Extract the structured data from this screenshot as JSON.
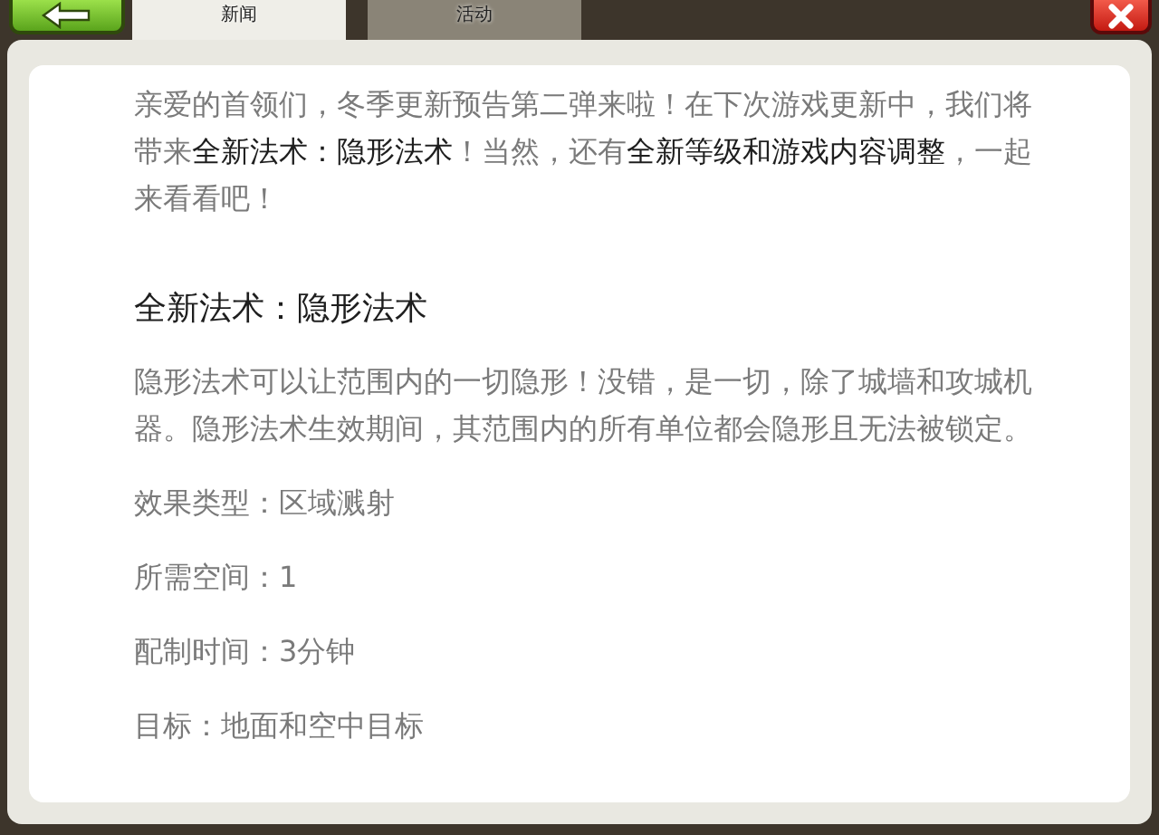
{
  "tabs": [
    {
      "label": "新闻",
      "selected": true
    },
    {
      "label": "活动",
      "selected": false
    }
  ],
  "article": {
    "intro": "亲爱的首领们，冬季更新预告第二弹来啦！在下次游戏更新中，我们将带来**全新法术：隐形法术**！当然，还有**全新等级和游戏内容调整**，一起来看看吧！",
    "heading": "全新法术：隐形法术",
    "description": "隐形法术可以让范围内的一切隐形！没错，是一切，除了城墙和攻城机器。隐形法术生效期间，其范围内的所有单位都会隐形且无法被锁定。",
    "facts": [
      "效果类型：区域溅射",
      "所需空间：1",
      "配制时间：3分钟",
      "目标：地面和空中目标"
    ]
  }
}
